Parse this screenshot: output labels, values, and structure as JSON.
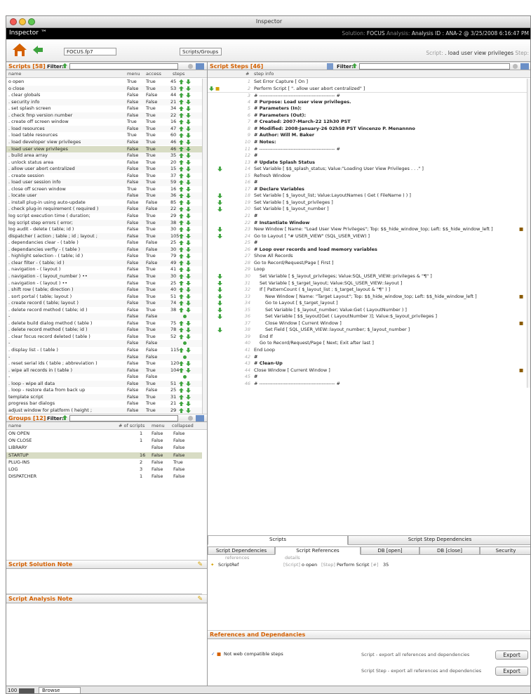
{
  "window_title": "Inspector",
  "app_title": "Inspector ™",
  "solution": {
    "label1": "Solution:",
    "name": "FOCUS",
    "label2": "Analysis:",
    "analysis": "Analysis ID : ANA-2 @ 3/25/2008 6:16:47 PM"
  },
  "toolbar": {
    "file": "FOCUS.fp7",
    "view": "Scripts/Groups",
    "script_label": "Script:",
    "script_name": ". load user view privileges",
    "step_label": "Step:"
  },
  "scripts": {
    "title": "Scripts [58]",
    "filter": "Filter:",
    "cols": [
      "name",
      "menu",
      "access",
      "steps"
    ],
    "rows": [
      [
        "o open",
        "True",
        "True",
        "45"
      ],
      [
        "o close",
        "False",
        "True",
        "53"
      ],
      [
        ". clear globals",
        "False",
        "False",
        "44"
      ],
      [
        ". security info",
        "False",
        "False",
        "21"
      ],
      [
        ". set splash screen",
        "False",
        "True",
        "34"
      ],
      [
        ". check fmp version number",
        "False",
        "True",
        "22"
      ],
      [
        ". create off screen window",
        "True",
        "True",
        "16"
      ],
      [
        ". load resources",
        "False",
        "True",
        "47"
      ],
      [
        ". load table resources",
        "True",
        "True",
        "60"
      ],
      [
        ". load developer view privileges",
        "False",
        "True",
        "46"
      ],
      [
        ". load user view privileges",
        "False",
        "True",
        "46"
      ],
      [
        ". build area array",
        "False",
        "True",
        "35"
      ],
      [
        ". unlock status area",
        "False",
        "True",
        "20"
      ],
      [
        ". allow user abort centralized",
        "False",
        "True",
        "15"
      ],
      [
        ". create session",
        "False",
        "True",
        "37"
      ],
      [
        ". load user session info",
        "False",
        "True",
        "59"
      ],
      [
        ". close off screen window",
        "True",
        "True",
        "16"
      ],
      [
        ". locate user",
        "False",
        "True",
        "36"
      ],
      [
        ". install plug-in using auto-update",
        "False",
        "False",
        "85"
      ],
      [
        ". check plug-in requirement ( required )",
        "False",
        "False",
        "22"
      ],
      [
        "log script execution time ( duration;",
        "False",
        "True",
        "29"
      ],
      [
        "log script step errors ( error;",
        "False",
        "True",
        "38"
      ],
      [
        "log audit - delete ( table; id )",
        "False",
        "True",
        "30"
      ],
      [
        "dispatcher ( action ; table ; id ; layout ;",
        "False",
        "True",
        "105"
      ],
      [
        ". dependancies clear - ( table )",
        "False",
        "False",
        "25"
      ],
      [
        ". dependancies verfiy - ( table )",
        "False",
        "False",
        "30"
      ],
      [
        ". highlight selection - ( table; id )",
        "False",
        "True",
        "79"
      ],
      [
        ". clear filter - ( table; id )",
        "False",
        "False",
        "49"
      ],
      [
        ". navigation - ( layout )",
        "False",
        "True",
        "41"
      ],
      [
        ". navigation - ( layout_number ) ••",
        "False",
        "True",
        "30"
      ],
      [
        ". navigation - ( layout ) ••",
        "False",
        "True",
        "25"
      ],
      [
        ". shift row ( table; direction )",
        "False",
        "True",
        "40"
      ],
      [
        ". sort portal ( table; layout )",
        "False",
        "True",
        "51"
      ],
      [
        ". create record ( table; layout )",
        "False",
        "True",
        "74"
      ],
      [
        ". delete record method ( table; id )",
        "False",
        "True",
        "38"
      ],
      [
        "-",
        "False",
        "False",
        ""
      ],
      [
        ". delete build dialog method ( table )",
        "False",
        "True",
        "75"
      ],
      [
        ". delete record method ( table; id )",
        "False",
        "True",
        "78"
      ],
      [
        ". clear focus record deleted ( table )",
        "False",
        "True",
        "52"
      ],
      [
        "-",
        "False",
        "False",
        ""
      ],
      [
        ". display list - ( table )",
        "False",
        "False",
        "115"
      ],
      [
        "-",
        "False",
        "False",
        ""
      ],
      [
        ". reset serial ids ( table ; abbreviation )",
        "False",
        "True",
        "120"
      ],
      [
        ". wipe all records in ( table )",
        "False",
        "True",
        "104"
      ],
      [
        "-",
        "False",
        "False",
        ""
      ],
      [
        ". loop - wipe all data",
        "False",
        "True",
        "51"
      ],
      [
        ". loop - restore data from back up",
        "False",
        "False",
        "25"
      ],
      [
        "template script",
        "False",
        "True",
        "31"
      ],
      [
        "progress bar dialogs",
        "False",
        "True",
        "21"
      ],
      [
        "adjust window for platform ( height ;",
        "False",
        "True",
        "29"
      ]
    ]
  },
  "groups": {
    "title": "Groups [12]",
    "filter": "Filter:",
    "cols": [
      "name",
      "# of scripts",
      "menu",
      "collapsed"
    ],
    "rows": [
      [
        "ON OPEN",
        "1",
        "False",
        "False"
      ],
      [
        "ON CLOSE",
        "1",
        "False",
        "False"
      ],
      [
        "LIBRARY",
        "",
        "False",
        "False"
      ],
      [
        "STARTUP",
        "16",
        "False",
        "False"
      ],
      [
        "PLUG-INS",
        "2",
        "False",
        "True"
      ],
      [
        "LOG",
        "3",
        "False",
        "False"
      ],
      [
        "DISPATCHER",
        "1",
        "False",
        "False"
      ]
    ]
  },
  "solution_note": "Script Solution Note",
  "analysis_note": "Script Analysis Note",
  "steps": {
    "title": "Script Steps [46]",
    "filter": "Filter:",
    "cols": [
      "#",
      "step info"
    ],
    "rows": [
      [
        "1",
        "Set Error Capture [ On ]"
      ],
      [
        "2",
        "Perform Script [ \". allow user abort centralized\" ]"
      ],
      [
        "3",
        "# ---------------------------------------------- #"
      ],
      [
        "4",
        "# Purpose: Load user view privileges."
      ],
      [
        "5",
        "# Parameters (In):"
      ],
      [
        "6",
        "# Parameters (Out):"
      ],
      [
        "7",
        "# Created: 2007-March-22 12h30 PST"
      ],
      [
        "8",
        "# Modified: 2008-January-26 02h58 PST Vincenzo P. Menannno"
      ],
      [
        "9",
        "# Author: Will M. Baker"
      ],
      [
        "10",
        "# Notes:"
      ],
      [
        "11",
        "# ---------------------------------------------- #"
      ],
      [
        "12",
        "#"
      ],
      [
        "13",
        "# Update Splash Status"
      ],
      [
        "14",
        "Set Variable [ $$_splash_status; Value:\"Loading User View Privileges . . .\" ]"
      ],
      [
        "15",
        "Refresh Window"
      ],
      [
        "16",
        "#"
      ],
      [
        "17",
        "# Declare Variables"
      ],
      [
        "18",
        "Set Variable [ $_layout_list; Value:LayoutNames ( Get ( FileName ) ) ]"
      ],
      [
        "19",
        "Set Variable [ $_layout_privileges ]"
      ],
      [
        "20",
        "Set Variable [ $_layout_number ]"
      ],
      [
        "21",
        "#"
      ],
      [
        "22",
        "# Instantiate Window"
      ],
      [
        "23",
        "New Window [ Name: \"Load User View Privileges\"; Top: $$_hide_window_top; Left: $$_hide_window_left ]"
      ],
      [
        "24",
        "Go to Layout [ \"# USER_VIEW\" (SQL_USER_VIEW) ]"
      ],
      [
        "25",
        "#"
      ],
      [
        "26",
        "# Loop over records and load memory variables"
      ],
      [
        "27",
        "Show All Records"
      ],
      [
        "28",
        "Go to Record/Request/Page [ First ]"
      ],
      [
        "29",
        "Loop"
      ],
      [
        "30",
        "Set Variable [ $_layout_privileges; Value:SQL_USER_VIEW::privileges & \"¶\" ]"
      ],
      [
        "31",
        "Set Variable [ $_target_layout; Value:SQL_USER_VIEW::layout ]"
      ],
      [
        "32",
        "If [ PatternCount ( $_layout_list ; $_target_layout & \"¶\" ) ]"
      ],
      [
        "33",
        "New Window [ Name: \"Target Layout\"; Top: $$_hide_window_top; Left: $$_hide_window_left ]"
      ],
      [
        "34",
        "Go to Layout [ $_target_layout ]"
      ],
      [
        "35",
        "Set Variable [ $_layout_number; Value:Get ( LayoutNumber ) ]"
      ],
      [
        "36",
        "Set Variable [ $$_layout[Get ( LayoutNumber )]; Value:$_layout_privileges ]"
      ],
      [
        "37",
        "Close Window [ Current Window ]"
      ],
      [
        "38",
        "Set Field [ SQL_USER_VIEW::layout_number; $_layout_number ]"
      ],
      [
        "39",
        "End If"
      ],
      [
        "40",
        "Go to Record/Request/Page [ Next; Exit after last ]"
      ],
      [
        "41",
        "End Loop"
      ],
      [
        "42",
        "#"
      ],
      [
        "43",
        "# Clean-Up"
      ],
      [
        "44",
        "Close Window [ Current Window ]"
      ],
      [
        "45",
        "#"
      ],
      [
        "46",
        "# ---------------------------------------------- #"
      ]
    ]
  },
  "tabs1": [
    "Scripts",
    "Script Step Dependencies"
  ],
  "tabs2": [
    "Script Dependencies",
    "Script References",
    "DB [open]",
    "DB [close]",
    "Security"
  ],
  "refs": {
    "cols": [
      "references",
      "details"
    ],
    "name": "ScriptRef",
    "d1": "[Script]",
    "d2": "o open",
    "d3": "[Step]",
    "d4": "Perform Script",
    "d5": "[#]",
    "d6": "35"
  },
  "refdep": {
    "title": "References and Dependancies",
    "note": "Not web compatible steps",
    "s1": "Script - export all references and dependencies",
    "s2": "Script Step - export all references and dependencies",
    "export": "Export"
  },
  "status": {
    "zoom": "100",
    "mode": "Browse"
  },
  "colors": {
    "accent": "#d46000",
    "selected": "#d8dcc4",
    "green": "#3da33d"
  }
}
